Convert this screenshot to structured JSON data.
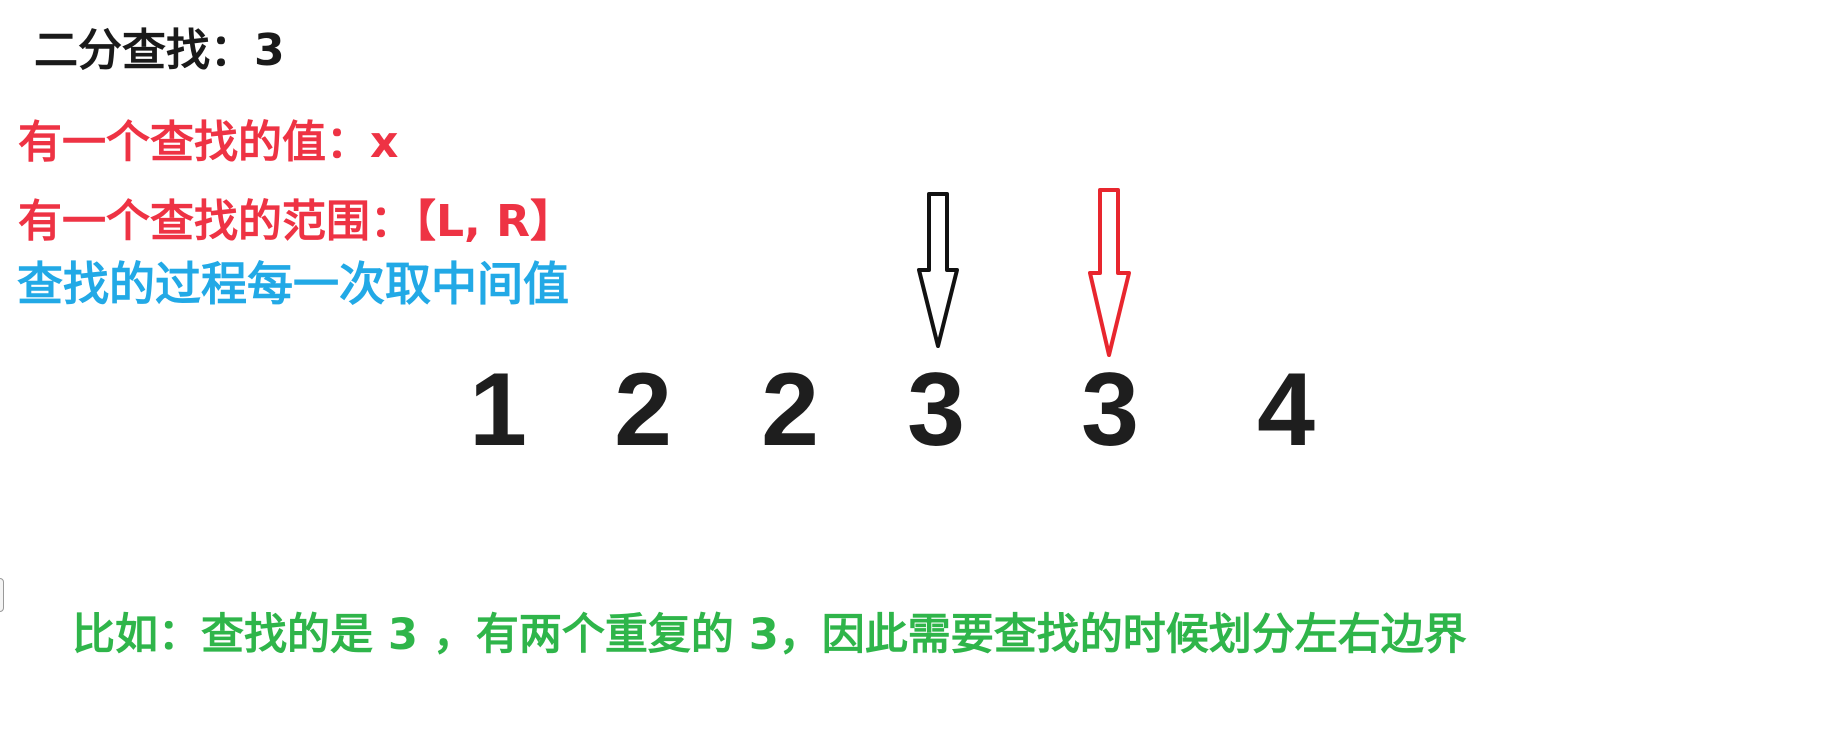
{
  "heading": "二分查找：3",
  "notes": {
    "value": "有一个查找的值：x",
    "range": "有一个查找的范围：【L, R】",
    "process": "查找的过程每一次取中间值"
  },
  "sequence": [
    "1",
    "2",
    "2",
    "3",
    "3",
    "4"
  ],
  "example": "比如：查找的是 3 ，有两个重复的 3，因此需要查找的时候划分左右边界",
  "colors": {
    "heading": "#1a1a1a",
    "notes": "#ee3344",
    "process": "#22a9e6",
    "example": "#2fb54a",
    "arrow_left": "#111111",
    "arrow_right": "#e8262e"
  },
  "icons": {
    "left_pointer": "down-arrow-icon",
    "right_pointer": "down-arrow-icon"
  }
}
